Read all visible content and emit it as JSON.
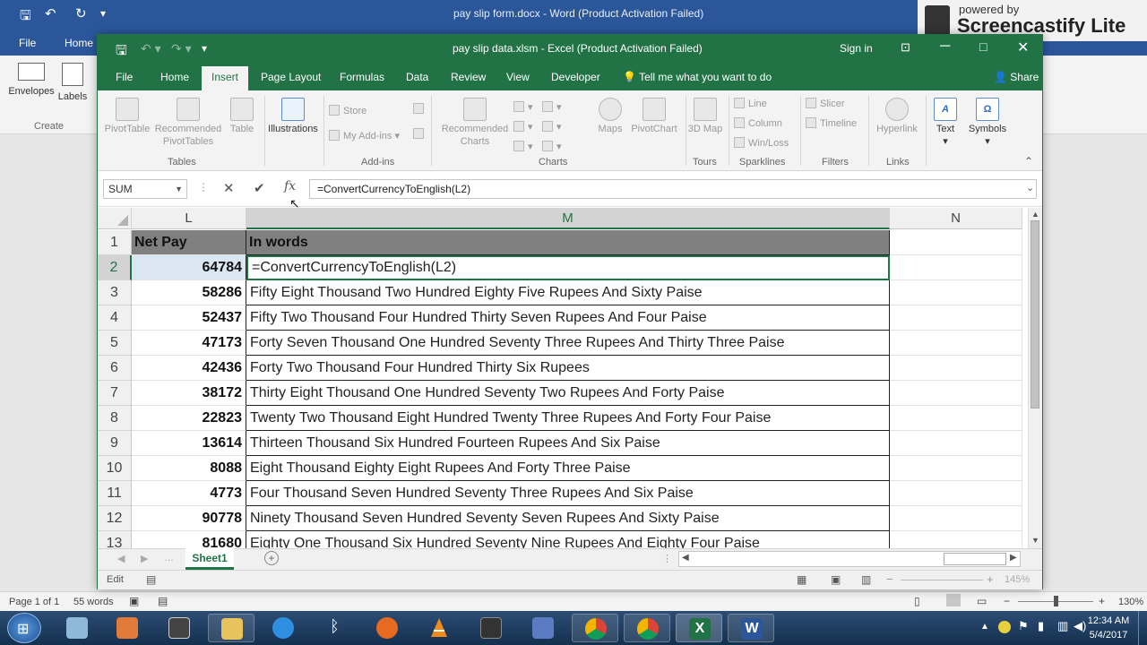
{
  "word": {
    "title": "pay slip form.docx  -  Word (Product Activation Failed)",
    "tabs": [
      "File",
      "Home"
    ],
    "ribbon": {
      "envelopes": "Envelopes",
      "labels": "Labels",
      "group": "Create"
    },
    "status": {
      "page": "Page 1 of 1",
      "words": "55 words",
      "zoom": "130%"
    }
  },
  "screencastify": {
    "powered": "powered by",
    "brand": "Screencastify Lite"
  },
  "excel": {
    "title": "pay slip data.xlsm  -  Excel (Product Activation Failed)",
    "sign_in": "Sign in",
    "share": "Share",
    "tabs": [
      "File",
      "Home",
      "Insert",
      "Page Layout",
      "Formulas",
      "Data",
      "Review",
      "View",
      "Developer"
    ],
    "active_tab": "Insert",
    "tell_me": "Tell me what you want to do",
    "ribbon": {
      "pivot": "PivotTable",
      "rec_pivot": "Recommended PivotTables",
      "table": "Table",
      "tables_group": "Tables",
      "illustrations": "Illustrations",
      "store": "Store",
      "my_addins": "My Add-ins",
      "addins_group": "Add-ins",
      "rec_charts": "Recommended Charts",
      "maps": "Maps",
      "pivotchart": "PivotChart",
      "charts_group": "Charts",
      "map3d": "3D Map",
      "tours_group": "Tours",
      "line": "Line",
      "column": "Column",
      "winloss": "Win/Loss",
      "sparklines_group": "Sparklines",
      "slicer": "Slicer",
      "timeline": "Timeline",
      "filters_group": "Filters",
      "hyperlink": "Hyperlink",
      "links_group": "Links",
      "text": "Text",
      "symbols": "Symbols"
    },
    "name_box": "SUM",
    "formula": "=ConvertCurrencyToEnglish(L2)",
    "columns": [
      "L",
      "M",
      "N"
    ],
    "header_row": {
      "num": "1",
      "l": "Net Pay",
      "m": "In words"
    },
    "rows": [
      {
        "num": "2",
        "l": "64784",
        "m": "=ConvertCurrencyToEnglish(L2)"
      },
      {
        "num": "3",
        "l": "58286",
        "m": "Fifty Eight Thousand Two Hundred Eighty Five Rupees And Sixty  Paise"
      },
      {
        "num": "4",
        "l": "52437",
        "m": "Fifty Two Thousand Four Hundred Thirty Seven Rupees And Four Paise"
      },
      {
        "num": "5",
        "l": "47173",
        "m": "Forty Seven Thousand One Hundred Seventy Three Rupees And Thirty Three Paise"
      },
      {
        "num": "6",
        "l": "42436",
        "m": "Forty Two Thousand Four Hundred Thirty Six Rupees"
      },
      {
        "num": "7",
        "l": "38172",
        "m": "Thirty Eight Thousand One Hundred Seventy Two Rupees And Forty  Paise"
      },
      {
        "num": "8",
        "l": "22823",
        "m": "Twenty Two Thousand Eight Hundred Twenty Three Rupees And Forty Four Paise"
      },
      {
        "num": "9",
        "l": "13614",
        "m": "Thirteen Thousand Six Hundred Fourteen Rupees And Six Paise"
      },
      {
        "num": "10",
        "l": "8088",
        "m": "Eight Thousand Eighty Eight Rupees And Forty Three Paise"
      },
      {
        "num": "11",
        "l": "4773",
        "m": "Four Thousand Seven Hundred Seventy Three Rupees And Six Paise"
      },
      {
        "num": "12",
        "l": "90778",
        "m": "Ninety  Thousand Seven Hundred Seventy Seven Rupees And Sixty  Paise"
      },
      {
        "num": "13",
        "l": "81680",
        "m": "Eighty One Thousand Six Hundred Seventy Nine Rupees And Eighty Four Paise"
      }
    ],
    "sheet_tab": "Sheet1",
    "status_mode": "Edit",
    "zoom": "145%"
  },
  "taskbar": {
    "time": "12:34 AM",
    "date": "5/4/2017"
  },
  "colors": {
    "excel_green": "#217346",
    "word_blue": "#2b579a",
    "taskbar": "#1c3a5e"
  }
}
